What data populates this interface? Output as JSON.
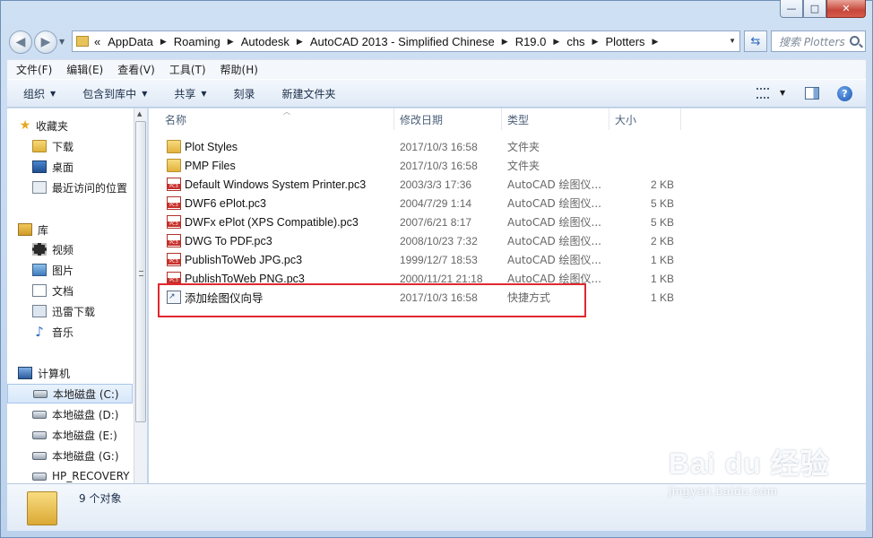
{
  "caption": {
    "min": "—",
    "max": "□",
    "close": "✕"
  },
  "address": {
    "prefix": "«",
    "segments": [
      "AppData",
      "Roaming",
      "Autodesk",
      "AutoCAD 2013 - Simplified Chinese",
      "R19.0",
      "chs",
      "Plotters"
    ],
    "search_placeholder": "搜索 Plotters"
  },
  "menu": [
    "文件(F)",
    "编辑(E)",
    "查看(V)",
    "工具(T)",
    "帮助(H)"
  ],
  "commands": [
    {
      "label": "组织",
      "dropdown": true
    },
    {
      "label": "包含到库中",
      "dropdown": true
    },
    {
      "label": "共享",
      "dropdown": true
    },
    {
      "label": "刻录",
      "dropdown": false
    },
    {
      "label": "新建文件夹",
      "dropdown": false
    }
  ],
  "nav": {
    "favorites": "收藏夹",
    "fav_items": [
      "下载",
      "桌面",
      "最近访问的位置"
    ],
    "library": "库",
    "lib_items": [
      "视频",
      "图片",
      "文档",
      "迅雷下载",
      "音乐"
    ],
    "computer": "计算机",
    "drives": [
      "本地磁盘 (C:)",
      "本地磁盘 (D:)",
      "本地磁盘 (E:)",
      "本地磁盘 (G:)",
      "HP_RECOVERY"
    ]
  },
  "columns": {
    "name": "名称",
    "date": "修改日期",
    "type": "类型",
    "size": "大小"
  },
  "files": [
    {
      "icon": "folder",
      "name": "Plot Styles",
      "date": "2017/10/3 16:58",
      "type": "文件夹",
      "size": ""
    },
    {
      "icon": "folder",
      "name": "PMP Files",
      "date": "2017/10/3 16:58",
      "type": "文件夹",
      "size": ""
    },
    {
      "icon": "pc3",
      "name": "Default Windows System Printer.pc3",
      "date": "2003/3/3 17:36",
      "type": "AutoCAD 绘图仪...",
      "size": "2 KB"
    },
    {
      "icon": "pc3",
      "name": "DWF6 ePlot.pc3",
      "date": "2004/7/29 1:14",
      "type": "AutoCAD 绘图仪...",
      "size": "5 KB"
    },
    {
      "icon": "pc3",
      "name": "DWFx ePlot (XPS Compatible).pc3",
      "date": "2007/6/21 8:17",
      "type": "AutoCAD 绘图仪...",
      "size": "5 KB"
    },
    {
      "icon": "pc3",
      "name": "DWG To PDF.pc3",
      "date": "2008/10/23 7:32",
      "type": "AutoCAD 绘图仪...",
      "size": "2 KB"
    },
    {
      "icon": "pc3",
      "name": "PublishToWeb JPG.pc3",
      "date": "1999/12/7 18:53",
      "type": "AutoCAD 绘图仪...",
      "size": "1 KB"
    },
    {
      "icon": "pc3",
      "name": "PublishToWeb PNG.pc3",
      "date": "2000/11/21 21:18",
      "type": "AutoCAD 绘图仪...",
      "size": "1 KB"
    },
    {
      "icon": "link",
      "name": "添加绘图仪向导",
      "date": "2017/10/3 16:58",
      "type": "快捷方式",
      "size": "1 KB"
    }
  ],
  "status": "9 个对象",
  "watermark": {
    "main": "Bai du 经验",
    "sub": "jingyan.baidu.com"
  },
  "colors": {
    "highlight": "#e0282e",
    "frame": "#c9dcf1"
  }
}
